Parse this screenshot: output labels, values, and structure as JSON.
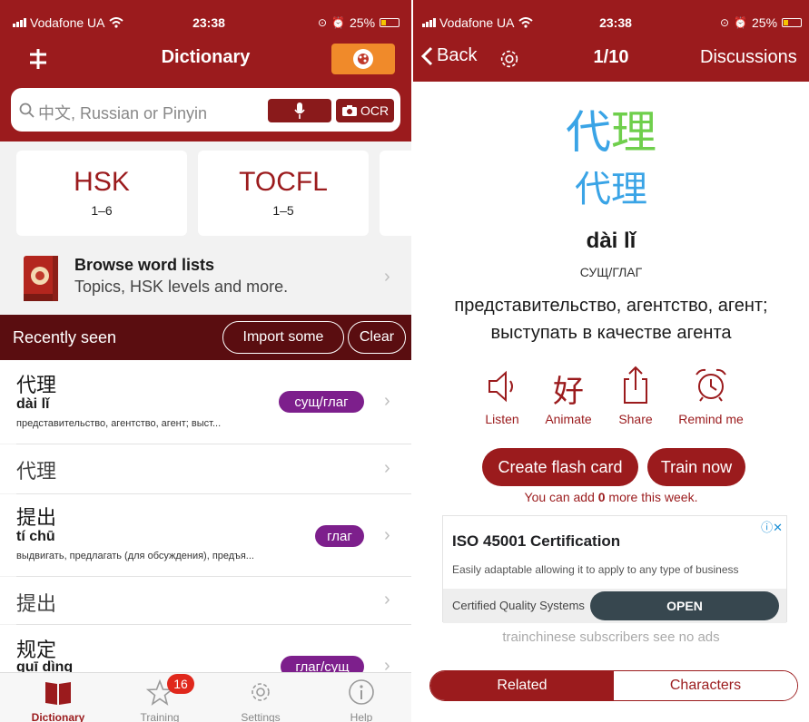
{
  "left": {
    "status": {
      "carrier": "Vodafone UA",
      "time": "23:38",
      "battery": "25%"
    },
    "nav": {
      "title": "Dictionary"
    },
    "search": {
      "placeholder": "中文, Russian or Pinyin",
      "ocr_label": "OCR"
    },
    "cards": [
      {
        "title": "HSK",
        "range": "1–6"
      },
      {
        "title": "TOCFL",
        "range": "1–5"
      }
    ],
    "browse": {
      "title": "Browse word lists",
      "subtitle": "Topics, HSK levels and more."
    },
    "recent": {
      "label": "Recently seen",
      "import_label": "Import some",
      "clear_label": "Clear"
    },
    "rows": [
      {
        "hanzi": "代理",
        "pinyin": "dài lǐ",
        "definition": "представительство, агентство, агент; выст...",
        "badge": "сущ/глаг"
      },
      {
        "hanzi": "代理"
      },
      {
        "hanzi": "提出",
        "pinyin": "tí chū",
        "definition": "выдвигать, предлагать (для обсуждения), предъя...",
        "badge": "глаг"
      },
      {
        "hanzi": "提出"
      },
      {
        "hanzi": "规定",
        "pinyin": "guī dìng",
        "badge": "глаг/сущ"
      }
    ],
    "tabs": [
      {
        "label": "Dictionary",
        "icon": "book-icon"
      },
      {
        "label": "Training",
        "icon": "star-icon",
        "badge": "16"
      },
      {
        "label": "Settings",
        "icon": "gear-icon"
      },
      {
        "label": "Help",
        "icon": "info-icon"
      }
    ],
    "colors": {
      "primary": "#9b1b1d",
      "dark_bar": "#5a0d10",
      "badge": "#7d1f8c",
      "accent_button": "#f08a2a"
    }
  },
  "right": {
    "status": {
      "carrier": "Vodafone UA",
      "time": "23:38",
      "battery": "25%"
    },
    "nav": {
      "back_label": "Back",
      "counter": "1/10",
      "discussions_label": "Discussions"
    },
    "word": {
      "hanzi_1": "代",
      "hanzi_2": "理",
      "pinyin": "dài lǐ",
      "pos": "СУЩ/ГЛАГ",
      "meaning": "представительство, агентство, агент; выступать в качестве агента"
    },
    "actions": [
      {
        "label": "Listen",
        "icon": "speaker-icon"
      },
      {
        "label": "Animate",
        "icon": "animate-character-icon",
        "glyph": "好"
      },
      {
        "label": "Share",
        "icon": "share-icon"
      },
      {
        "label": "Remind me",
        "icon": "alarm-clock-icon"
      }
    ],
    "buttons": {
      "flash_card": "Create flash card",
      "train_now": "Train now"
    },
    "add_note": {
      "before": "You can add ",
      "count": "0",
      "after": " more this week."
    },
    "ad": {
      "title": "ISO 45001 Certification",
      "body": "Easily adaptable allowing it to apply to any type of business",
      "source": "Certified Quality Systems",
      "cta": "OPEN"
    },
    "no_ads": "trainchinese subscribers see no ads",
    "segment": {
      "related": "Related",
      "characters": "Characters"
    },
    "colors": {
      "hanzi_blue": "#3aa4e6",
      "hanzi_green": "#6fcf4c"
    }
  }
}
